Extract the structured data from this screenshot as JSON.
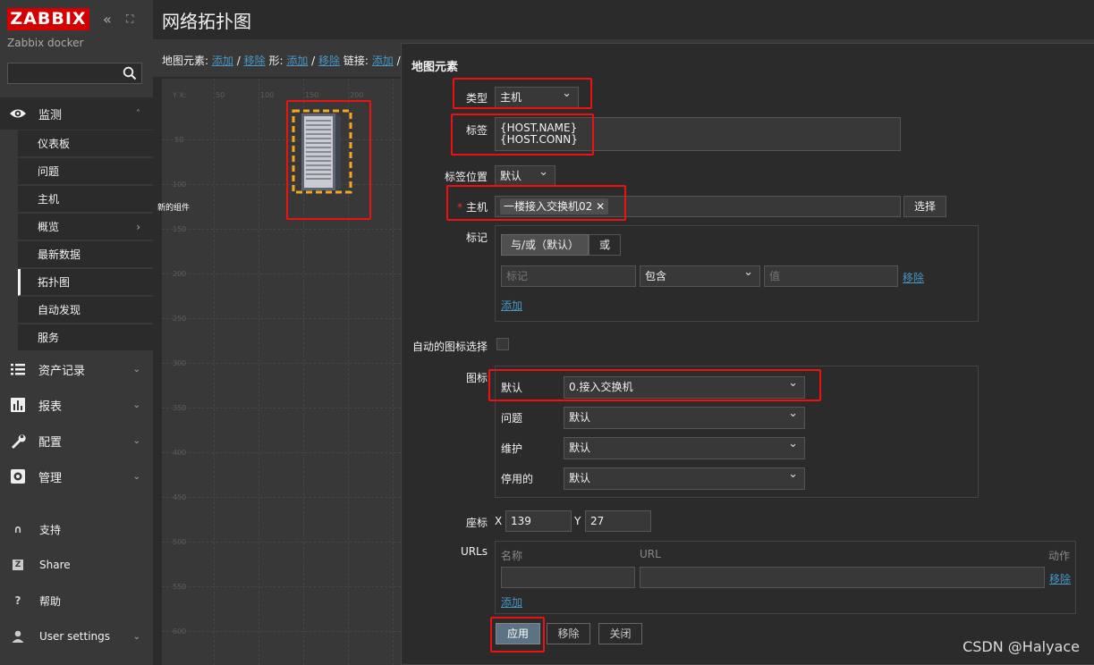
{
  "sidebar": {
    "logo": "ZABBIX",
    "server_name": "Zabbix docker",
    "collapse_icon": "double-chevron-left-icon",
    "kiosk_icon": "expand-icon",
    "search_placeholder": "",
    "monitoring": {
      "label": "监测",
      "items": [
        {
          "label": "仪表板"
        },
        {
          "label": "问题"
        },
        {
          "label": "主机"
        },
        {
          "label": "概览"
        },
        {
          "label": "最新数据"
        },
        {
          "label": "拓扑图"
        },
        {
          "label": "自动发现"
        },
        {
          "label": "服务"
        }
      ]
    },
    "sections": [
      {
        "label": "资产记录"
      },
      {
        "label": "报表"
      },
      {
        "label": "配置"
      },
      {
        "label": "管理"
      }
    ],
    "footer": [
      {
        "label": "支持"
      },
      {
        "label": "Share"
      },
      {
        "label": "帮助"
      },
      {
        "label": "User settings"
      }
    ]
  },
  "page": {
    "title": "网络拓扑图"
  },
  "toolbar": {
    "map_elements": "地图元素:",
    "shapes": "形:",
    "links": "链接:",
    "add": "添加",
    "remove": "移除",
    "sep": "/"
  },
  "canvas": {
    "x_ticks": [
      "Y X:",
      "50",
      "100",
      "150",
      "200"
    ],
    "y_ticks": [
      "50",
      "100",
      "150",
      "200",
      "250",
      "300",
      "350",
      "400",
      "450",
      "500",
      "550",
      "600"
    ],
    "element_label": "新的组件"
  },
  "form": {
    "header": "地图元素",
    "type_label": "类型",
    "type_value": "主机",
    "label_label": "标签",
    "label_line1": "{HOST.NAME}",
    "label_line2": "{HOST.CONN}",
    "label_location_label": "标签位置",
    "label_location_value": "默认",
    "host_label": "主机",
    "host_chip": "一楼接入交换机02",
    "select_button": "选择",
    "tags_label": "标记",
    "and_or": "与/或（默认）",
    "or": "或",
    "tag_placeholder": "标记",
    "tag_operator": "包含",
    "value_placeholder": "值",
    "remove_link": "移除",
    "add_link": "添加",
    "auto_icon_label": "自动的图标选择",
    "icons_label": "图标",
    "icon_default_label": "默认",
    "icon_default_value": "0.接入交换机",
    "icon_problem_label": "问题",
    "icon_problem_value": "默认",
    "icon_maintenance_label": "维护",
    "icon_maintenance_value": "默认",
    "icon_disabled_label": "停用的",
    "icon_disabled_value": "默认",
    "coord_label": "座标",
    "x_label": "X",
    "x_value": "139",
    "y_label": "Y",
    "y_value": "27",
    "urls_label": "URLs",
    "url_name_header": "名称",
    "url_header": "URL",
    "action_header": "动作",
    "url_remove": "移除",
    "url_add": "添加",
    "apply_button": "应用",
    "remove_button": "移除",
    "close_button": "关闭"
  },
  "watermark": "CSDN @Halyace",
  "colors": {
    "highlight": "#ee1111",
    "selection": "#f5a623",
    "link": "#4796c4",
    "logo": "#d40000"
  }
}
